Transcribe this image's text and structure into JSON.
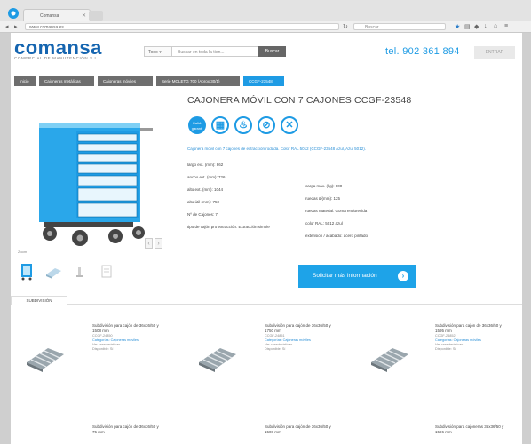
{
  "browser": {
    "tab_title": "Comansa",
    "url": "www.comansa.es",
    "search_placeholder": "Buscar"
  },
  "header": {
    "brand": "comansa",
    "brand_sub": "COMERCIAL DE MANUTENCIÓN S.L.",
    "select_label": "Todo",
    "search_placeholder": "Buscar en toda la tien...",
    "search_button": "Buscar",
    "phone": "tel. 902 361 894",
    "login_label": "ENTRAR"
  },
  "breadcrumb": [
    "Inicio",
    "Cajoneras metálicas",
    "Cajoneras móviles",
    "Serie MOLETG 700 (Aprox 30/1)",
    "CCGF-23548"
  ],
  "product": {
    "title": "CAJONERA MÓVIL CON 7 CAJONES CCGF-23548",
    "feature_badge": "Calid. garant.",
    "description": "Cajonera móvil con 7 cajones de extracción rodada. Color RAL 5012 (CCGF-23548 Azul, Azul 5012).",
    "specs_left": [
      "largo ext. (mm): 862",
      "ancho ext. (mm): 726",
      "alto ext. (mm): 1044",
      "alto útil (mm): 750",
      "Nº de Cajones: 7",
      "tipo de cajón pro extracción: Extracción simple"
    ],
    "specs_right": [
      "carga máx. (kg): 800",
      "ruedas Ø(mm): 125",
      "ruedas material: Goma endurecida",
      "color RAL: 5012 azul",
      "extensión / acabado: acero pintado"
    ],
    "info_button": "Solicitar más información",
    "zoom_label": "Zoom"
  },
  "tabs": {
    "subdivision": "SUBDIVISIÓN"
  },
  "products": [
    {
      "name": "Subdivisión para cajón de 36x36/50 y 1508 mm",
      "code": "CCGF-24850",
      "meta1": "Categorías: Cajoneras móviles",
      "meta2": "Ver características",
      "meta3": "Disponible: Sí"
    },
    {
      "name": "Subdivisión para cajón de 36x36/50 y 1750 mm",
      "code": "CCGF-24851",
      "meta1": "Categorías: Cajoneras móviles",
      "meta2": "Ver características",
      "meta3": "Disponible: Sí"
    },
    {
      "name": "Subdivisión para cajón de 36x36/50 y 1595 mm",
      "code": "CCGF-24852",
      "meta1": "Categorías: Cajoneras móviles",
      "meta2": "Ver características",
      "meta3": "Disponible: Sí"
    },
    {
      "name": "Subdivisión para cajón de 36x36/50 y 75 mm",
      "code": "",
      "meta1": "",
      "meta2": "",
      "meta3": ""
    },
    {
      "name": "Subdivisión para cajón de 36x36/50 y 1508 mm",
      "code": "",
      "meta1": "",
      "meta2": "",
      "meta3": ""
    },
    {
      "name": "Subdivisión para cajoneras 36x36/50 y 1596 mm",
      "code": "",
      "meta1": "",
      "meta2": "",
      "meta3": ""
    }
  ]
}
